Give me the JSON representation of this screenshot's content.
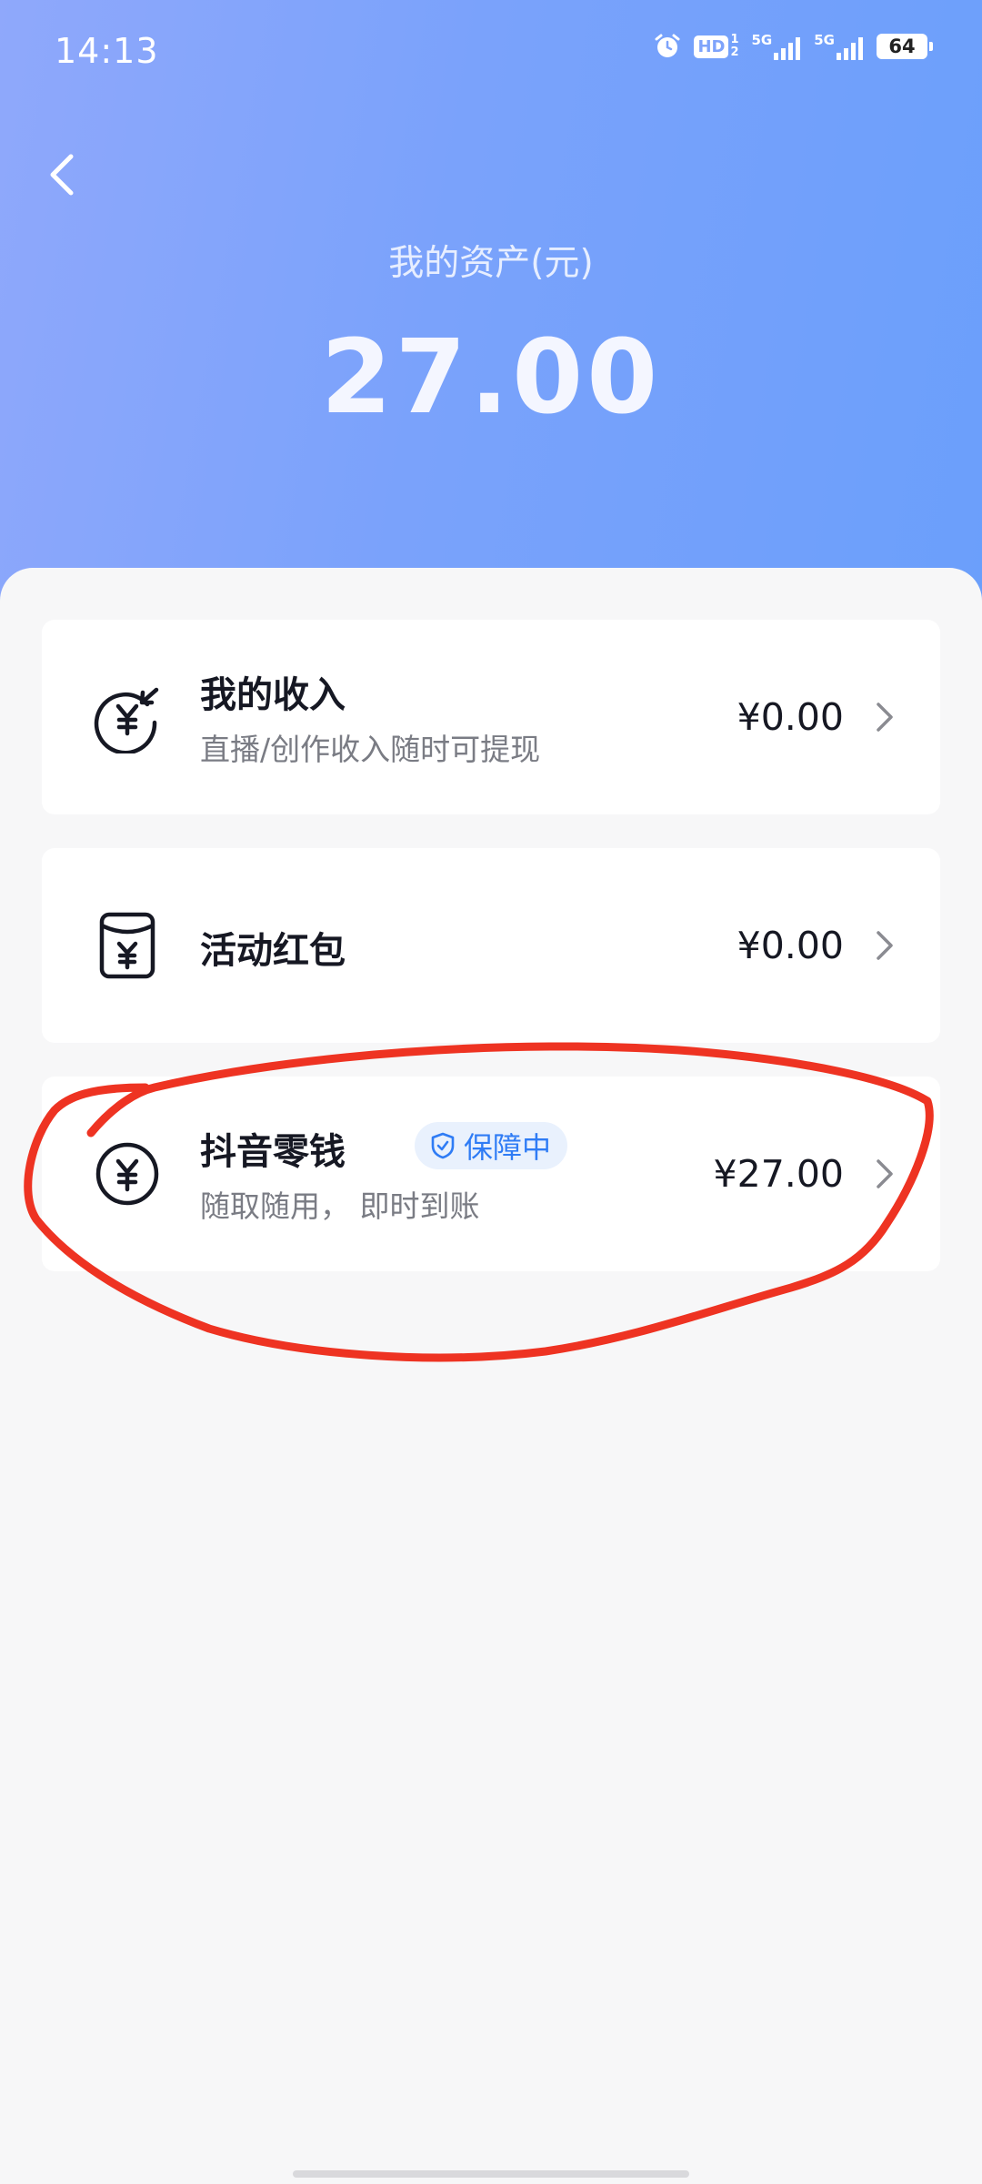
{
  "status_bar": {
    "time": "14:13",
    "hd_label": "HD",
    "hd_sub_top": "1",
    "hd_sub_bottom": "2",
    "signal1_label": "5G",
    "signal2_label": "5G",
    "battery": "64"
  },
  "header": {
    "title": "我的资产(元)",
    "amount": "27.00"
  },
  "cards": [
    {
      "title": "我的收入",
      "subtitle": "直播/创作收入随时可提现",
      "amount": "¥0.00"
    },
    {
      "title": "活动红包",
      "amount": "¥0.00"
    },
    {
      "title": "抖音零钱",
      "badge": "保障中",
      "subtitle": "随取随用， 即时到账",
      "amount": "¥27.00"
    }
  ],
  "colors": {
    "header_gradient_start": "#8fa8fb",
    "header_gradient_end": "#6b9ffb",
    "badge_text": "#2f7cf5",
    "badge_bg": "#e9f1fd",
    "annotation_stroke": "#ee3322"
  },
  "icons": {
    "back": "chevron-left-icon",
    "income": "yen-circle-arrow-icon",
    "red_packet": "yen-envelope-icon",
    "wallet": "yen-circle-icon",
    "badge": "shield-check-icon",
    "row_arrow": "chevron-right-icon"
  }
}
